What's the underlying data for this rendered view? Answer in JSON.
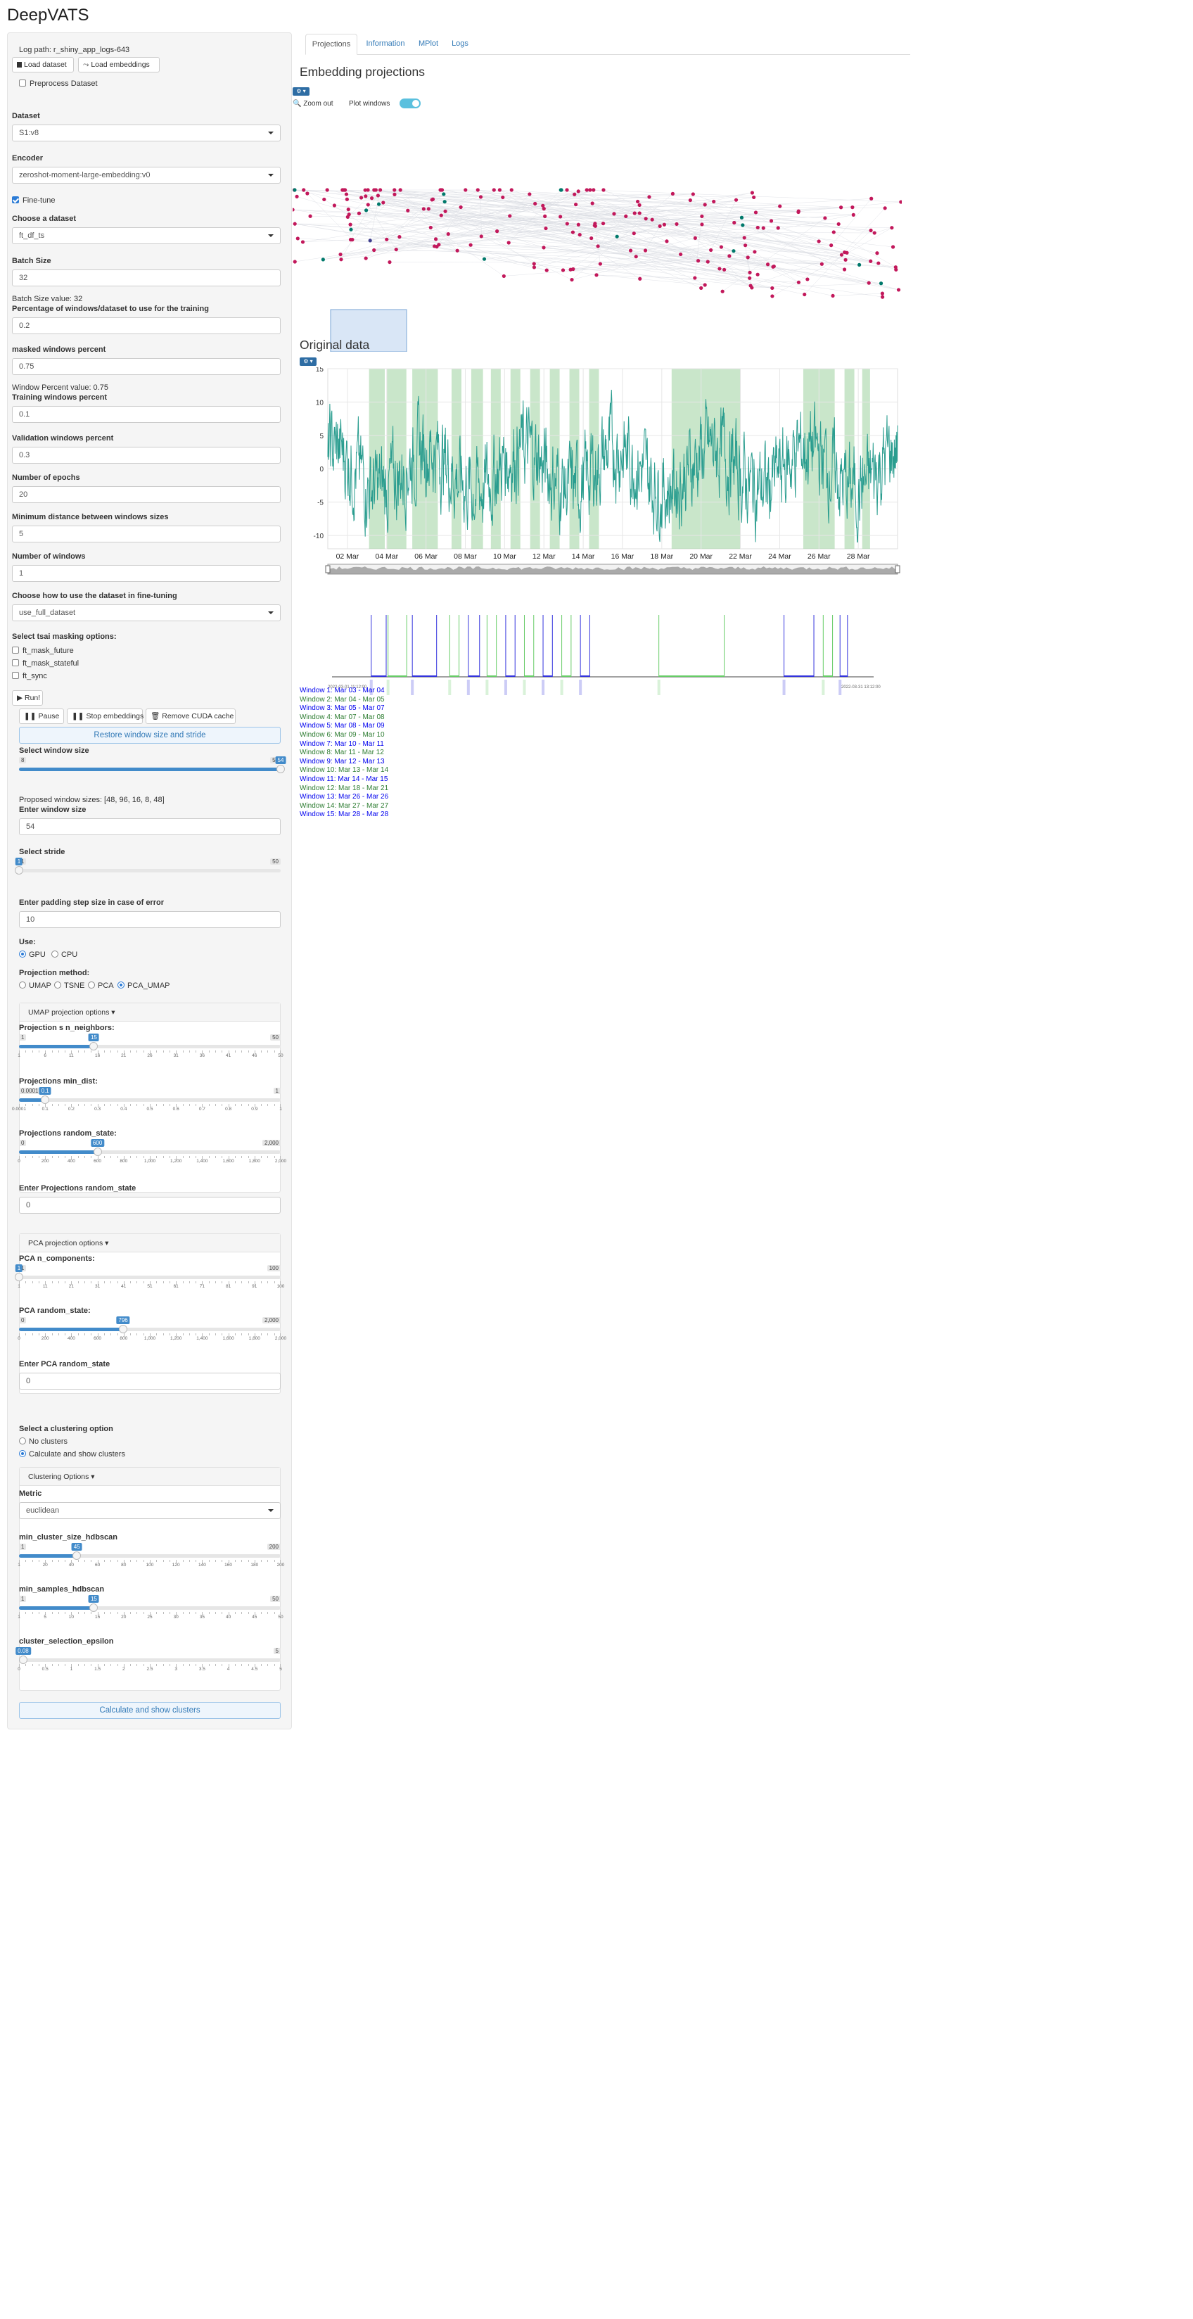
{
  "app_title": "DeepVATS",
  "sidebar": {
    "log_path": "Log path: r_shiny_app_logs-643",
    "load_dataset": "Load dataset",
    "load_embeddings": "Load embeddings",
    "preprocess": "Preprocess Dataset",
    "dataset_label": "Dataset",
    "dataset_value": "S1:v8",
    "encoder_label": "Encoder",
    "encoder_value": "zeroshot-moment-large-embedding:v0",
    "fine_tune": "Fine-tune",
    "choose_dataset_label": "Choose a dataset",
    "choose_dataset_value": "ft_df_ts",
    "batch_size_label": "Batch Size",
    "batch_size_value": "32",
    "batch_size_info": "Batch Size value: 32",
    "percentage_label": "Percentage of windows/dataset to use for the training",
    "percentage_value": "0.2",
    "masked_label": "masked windows percent",
    "masked_value": "0.75",
    "window_percent_info": "Window Percent value: 0.75",
    "training_label": "Training windows percent",
    "training_value": "0.1",
    "validation_label": "Validation windows percent",
    "validation_value": "0.3",
    "epochs_label": "Number of epochs",
    "epochs_value": "20",
    "min_distance_label": "Minimum distance between windows sizes",
    "min_distance_value": "5",
    "num_windows_label": "Number of windows",
    "num_windows_value": "1",
    "how_label": "Choose how to use the dataset in fine-tuning",
    "how_value": "use_full_dataset",
    "masking_label": "Select tsai masking options:",
    "mask_future": "ft_mask_future",
    "mask_stateful": "ft_mask_stateful",
    "mask_sync": "ft_sync",
    "run": "Run!",
    "pause": "Pause",
    "stop_embeddings": "Stop embeddings",
    "remove_cuda": "Remove CUDA cache",
    "restore": "Restore window size and stride",
    "select_window_label": "Select window size",
    "proposed": "Proposed window sizes: [48, 96, 16, 8, 48]",
    "enter_window_label": "Enter window size",
    "enter_window_value": "54",
    "stride_label": "Select stride",
    "padding_label": "Enter padding step size in case of error",
    "padding_value": "10",
    "use_label": "Use:",
    "use_gpu": "GPU",
    "use_cpu": "CPU",
    "projection_method_label": "Projection method:",
    "proj_umap": "UMAP",
    "proj_tsne": "TSNE",
    "proj_pca": "PCA",
    "proj_pca_umap": "PCA_UMAP",
    "umap_options": "UMAP projection options",
    "n_neighbors_label": "Projection s n_neighbors:",
    "min_dist_label": "Projections min_dist:",
    "random_state_label": "Projections random_state:",
    "enter_random_state_label": "Enter Projections random_state",
    "enter_random_state_value": "0",
    "pca_options": "PCA projection options",
    "pca_n_components_label": "PCA n_components:",
    "pca_random_state_label": "PCA random_state:",
    "enter_pca_random_label": "Enter PCA random_state",
    "enter_pca_random_value": "0",
    "clustering_option_label": "Select a clustering option",
    "no_clusters": "No clusters",
    "calc_clusters": "Calculate and show clusters",
    "clustering_options": "Clustering Options",
    "metric_label": "Metric",
    "metric_value": "euclidean",
    "min_cluster_label": "min_cluster_size_hdbscan",
    "min_samples_label": "min_samples_hdbscan",
    "epsilon_label": "cluster_selection_epsilon",
    "calc_button": "Calculate and show clusters"
  },
  "sliders": {
    "window": {
      "min": "8",
      "max": "54",
      "value": "54",
      "fraction": 1.0
    },
    "stride": {
      "min": "1",
      "max": "50",
      "value": "1",
      "fraction": 0.0
    },
    "n_neighbors": {
      "min": "1",
      "max": "50",
      "value": "15",
      "fraction": 0.286,
      "ticks": [
        "1",
        "6",
        "11",
        "16",
        "21",
        "26",
        "31",
        "36",
        "41",
        "46",
        "50"
      ]
    },
    "min_dist": {
      "min": "0.0001",
      "max": "1",
      "value": "0.1",
      "fraction": 0.1,
      "ticks": [
        "0.0001",
        "0.1",
        "0.2",
        "0.3",
        "0.4",
        "0.5",
        "0.6",
        "0.7",
        "0.8",
        "0.9",
        "1"
      ]
    },
    "random_state": {
      "min": "0",
      "max": "2,000",
      "value": "600",
      "fraction": 0.3,
      "ticks": [
        "0",
        "200",
        "400",
        "600",
        "800",
        "1,000",
        "1,200",
        "1,400",
        "1,600",
        "1,800",
        "2,000"
      ]
    },
    "pca_n_components": {
      "min": "1",
      "max": "100",
      "value": "1",
      "fraction": 0.0,
      "ticks": [
        "1",
        "11",
        "21",
        "31",
        "41",
        "51",
        "61",
        "71",
        "81",
        "91",
        "100"
      ]
    },
    "pca_random_state": {
      "min": "0",
      "max": "2,000",
      "value": "796",
      "fraction": 0.398,
      "ticks": [
        "0",
        "200",
        "400",
        "600",
        "800",
        "1,000",
        "1,200",
        "1,400",
        "1,600",
        "1,800",
        "2,000"
      ]
    },
    "min_cluster_size": {
      "min": "1",
      "max": "200",
      "value": "45",
      "fraction": 0.221,
      "ticks": [
        "1",
        "20",
        "40",
        "60",
        "80",
        "100",
        "120",
        "140",
        "160",
        "180",
        "200"
      ]
    },
    "min_samples": {
      "min": "1",
      "max": "50",
      "value": "15",
      "fraction": 0.286,
      "ticks": [
        "1",
        "5",
        "10",
        "15",
        "20",
        "25",
        "30",
        "35",
        "40",
        "45",
        "50"
      ]
    },
    "epsilon": {
      "min": "0",
      "max": "5",
      "value": "0.08",
      "fraction": 0.016,
      "ticks": [
        "0",
        "0.5",
        "1",
        "1.5",
        "2",
        "2.5",
        "3",
        "3.5",
        "4",
        "4.5",
        "5"
      ]
    }
  },
  "tabs": [
    "Projections",
    "Information",
    "MPlot",
    "Logs"
  ],
  "embedding_title": "Embedding projections",
  "zoom_out": "Zoom out",
  "plot_windows": "Plot windows",
  "original_data_title": "Original data",
  "chart_data": {
    "type": "line",
    "x_tick_labels": [
      "02 Mar",
      "04 Mar",
      "06 Mar",
      "08 Mar",
      "10 Mar",
      "12 Mar",
      "14 Mar",
      "16 Mar",
      "18 Mar",
      "20 Mar",
      "22 Mar",
      "24 Mar",
      "26 Mar",
      "28 Mar"
    ],
    "y_tick_labels": [
      "15",
      "10",
      "5",
      "0",
      "-5",
      "-10"
    ],
    "ylim": [
      -12,
      15
    ],
    "color": "#2a9d8f",
    "highlight_color": "#a5d6a7",
    "highlight_windows_days": [
      [
        3.1,
        3.9
      ],
      [
        4.0,
        5.0
      ],
      [
        5.3,
        6.6
      ],
      [
        7.3,
        7.8
      ],
      [
        8.3,
        8.9
      ],
      [
        9.3,
        9.8
      ],
      [
        10.3,
        10.8
      ],
      [
        11.3,
        11.8
      ],
      [
        12.3,
        12.8
      ],
      [
        13.3,
        13.8
      ],
      [
        14.3,
        14.8
      ],
      [
        18.5,
        22.0
      ],
      [
        25.2,
        26.8
      ],
      [
        27.3,
        27.8
      ],
      [
        28.2,
        28.6
      ]
    ]
  },
  "timeline": {
    "start_label": "2022-03-01 11:12:00",
    "end_label": "2022-03-31 13:12:00"
  },
  "windows": [
    {
      "label": "Window 1: Mar 03 - Mar 04",
      "color": "#0000ee"
    },
    {
      "label": "Window 2: Mar 04 - Mar 05",
      "color": "#2e7d32"
    },
    {
      "label": "Window 3: Mar 05 - Mar 07",
      "color": "#0000ee"
    },
    {
      "label": "Window 4: Mar 07 - Mar 08",
      "color": "#2e7d32"
    },
    {
      "label": "Window 5: Mar 08 - Mar 09",
      "color": "#0000ee"
    },
    {
      "label": "Window 6: Mar 09 - Mar 10",
      "color": "#2e7d32"
    },
    {
      "label": "Window 7: Mar 10 - Mar 11",
      "color": "#0000ee"
    },
    {
      "label": "Window 8: Mar 11 - Mar 12",
      "color": "#2e7d32"
    },
    {
      "label": "Window 9: Mar 12 - Mar 13",
      "color": "#0000ee"
    },
    {
      "label": "Window 10: Mar 13 - Mar 14",
      "color": "#2e7d32"
    },
    {
      "label": "Window 11: Mar 14 - Mar 15",
      "color": "#0000ee"
    },
    {
      "label": "Window 12: Mar 18 - Mar 21",
      "color": "#2e7d32"
    },
    {
      "label": "Window 13: Mar 26 - Mar 26",
      "color": "#0000ee"
    },
    {
      "label": "Window 14: Mar 27 - Mar 27",
      "color": "#2e7d32"
    },
    {
      "label": "Window 15: Mar 28 - Mar 28",
      "color": "#0000ee"
    }
  ],
  "colors": {
    "accent": "#337ab7",
    "point_magenta": "#c2185b",
    "point_teal": "#00796b",
    "point_navy": "#3f3f8f",
    "slider_blue": "#428bca"
  }
}
